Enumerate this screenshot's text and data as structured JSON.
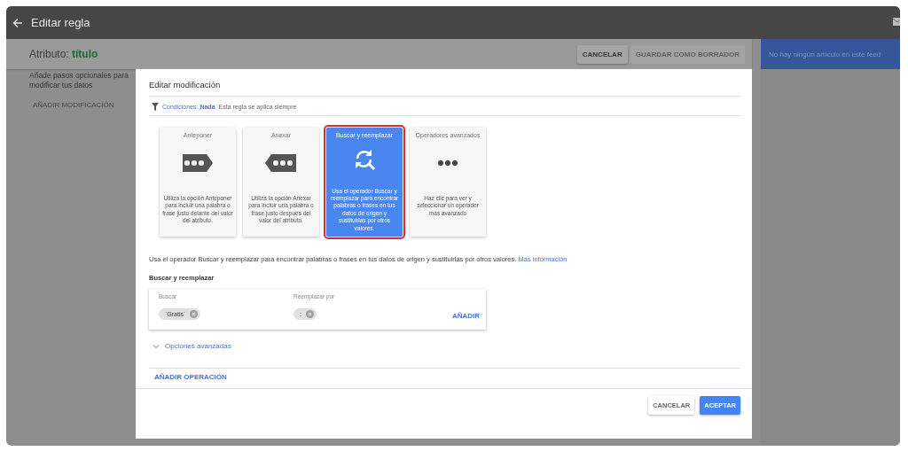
{
  "window": {
    "title": "Editar regla"
  },
  "header": {
    "attribute_label": "Atributo:",
    "attribute_value": "título",
    "buttons": [
      {
        "label": "CANCELAR",
        "disabled": false
      },
      {
        "label": "GUARDAR COMO BORRADOR",
        "disabled": true
      }
    ]
  },
  "side_panel": {
    "message": "No hay ningún artículo en este feed"
  },
  "sidebar": {
    "text": "Añade pasos opcionales para modificar tus datos",
    "button": "AÑADIR MODIFICACIÓN"
  },
  "dialog": {
    "title": "Editar modificación",
    "conditions": {
      "label": "Condiciones:",
      "value": "Nada",
      "note": "Esta regla se aplica siempre"
    },
    "operators": [
      {
        "kind": "prepend",
        "title": "Anteponer",
        "description": "Utiliza la opción Anteponer para incluir una palabra o frase justo delante del valor del atributo.",
        "selected": false
      },
      {
        "kind": "append",
        "title": "Anexar",
        "description": "Utiliza la opción Anexar para incluir una palabra o frase justo después del valor del atributo.",
        "selected": false
      },
      {
        "kind": "replace",
        "title": "Buscar y reemplazar",
        "description": "Usa el operador Buscar y reemplazar para encontrar palabras o frases en tus datos de origen y sustituirlas por otros valores.",
        "selected": true
      },
      {
        "kind": "advanced",
        "title": "Operadores avanzados",
        "description": "Haz clic para ver y seleccionar un operador más avanzado",
        "selected": false
      }
    ],
    "description": "Usa el operador Buscar y reemplazar para encontrar palabras o frases en tus datos de origen y sustituirlas por otros valores.",
    "link": "Más información",
    "section_title": "Buscar y reemplazar",
    "fields": [
      {
        "label": "Buscar",
        "chips": [
          "`Gratis`"
        ]
      },
      {
        "label": "Reemplazar por",
        "chips": [
          ":"
        ]
      }
    ],
    "add_button": "AÑADIR",
    "advanced_options": {
      "label": "Opciones avanzadas",
      "expanded": false
    },
    "add_operation": "AÑADIR OPERACIÓN",
    "buttons": [
      {
        "label": "CANCELAR",
        "primary": false
      },
      {
        "label": "ACEPTAR",
        "primary": true
      }
    ]
  }
}
